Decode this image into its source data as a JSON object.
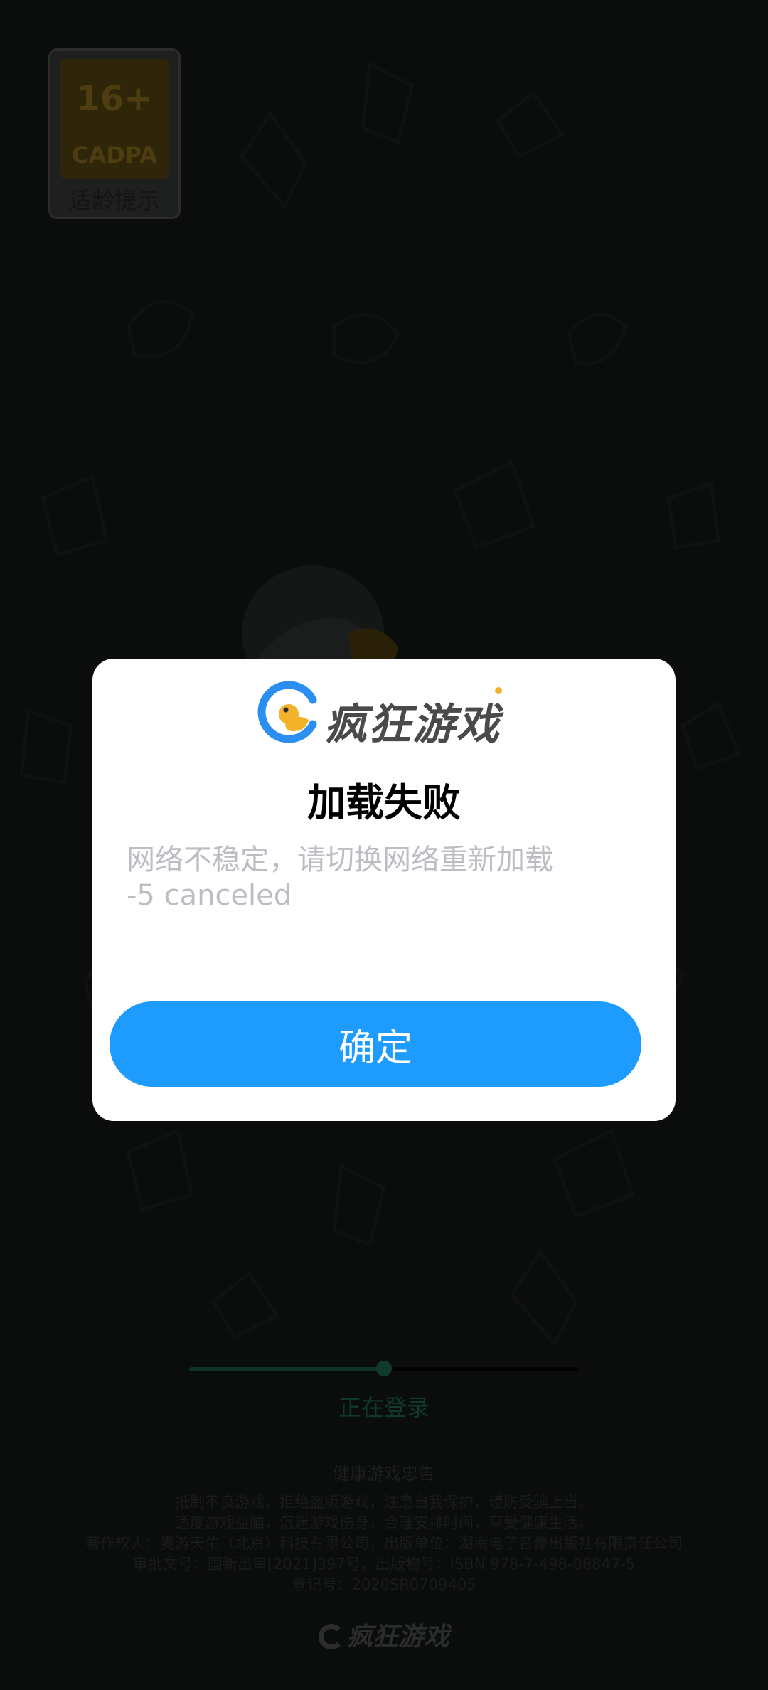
{
  "age_badge": {
    "rating": "16+",
    "org": "CADPA",
    "caption": "适龄提示"
  },
  "dialog": {
    "brand": "疯狂游戏",
    "title": "加载失败",
    "message_lines": [
      "网络不稳定，请切换网络重新加载",
      "-5 canceled"
    ],
    "confirm_label": "确定"
  },
  "login": {
    "progress": 0.5,
    "status": "正在登录"
  },
  "health_notice": {
    "title": "健康游戏忠告",
    "lines": [
      "抵制不良游戏，拒绝盗版游戏，注意自我保护，谨防受骗上当。",
      "适度游戏益脑，沉迷游戏伤身，合理安排时间，享受健康生活。",
      "著作权人：麦游天佑（北京）科技有限公司，出版单位：湖南电子音像出版社有限责任公司",
      "审批文号：国新出审[2021]397号，出版物号：ISBN 978-7-498-08847-5",
      "登记号：2020SR0709405"
    ]
  },
  "footer": {
    "brand": "疯狂游戏"
  },
  "colors": {
    "accent": "#1e9bff",
    "brand_yellow": "#f2b32a",
    "progress": "#0e3226"
  }
}
